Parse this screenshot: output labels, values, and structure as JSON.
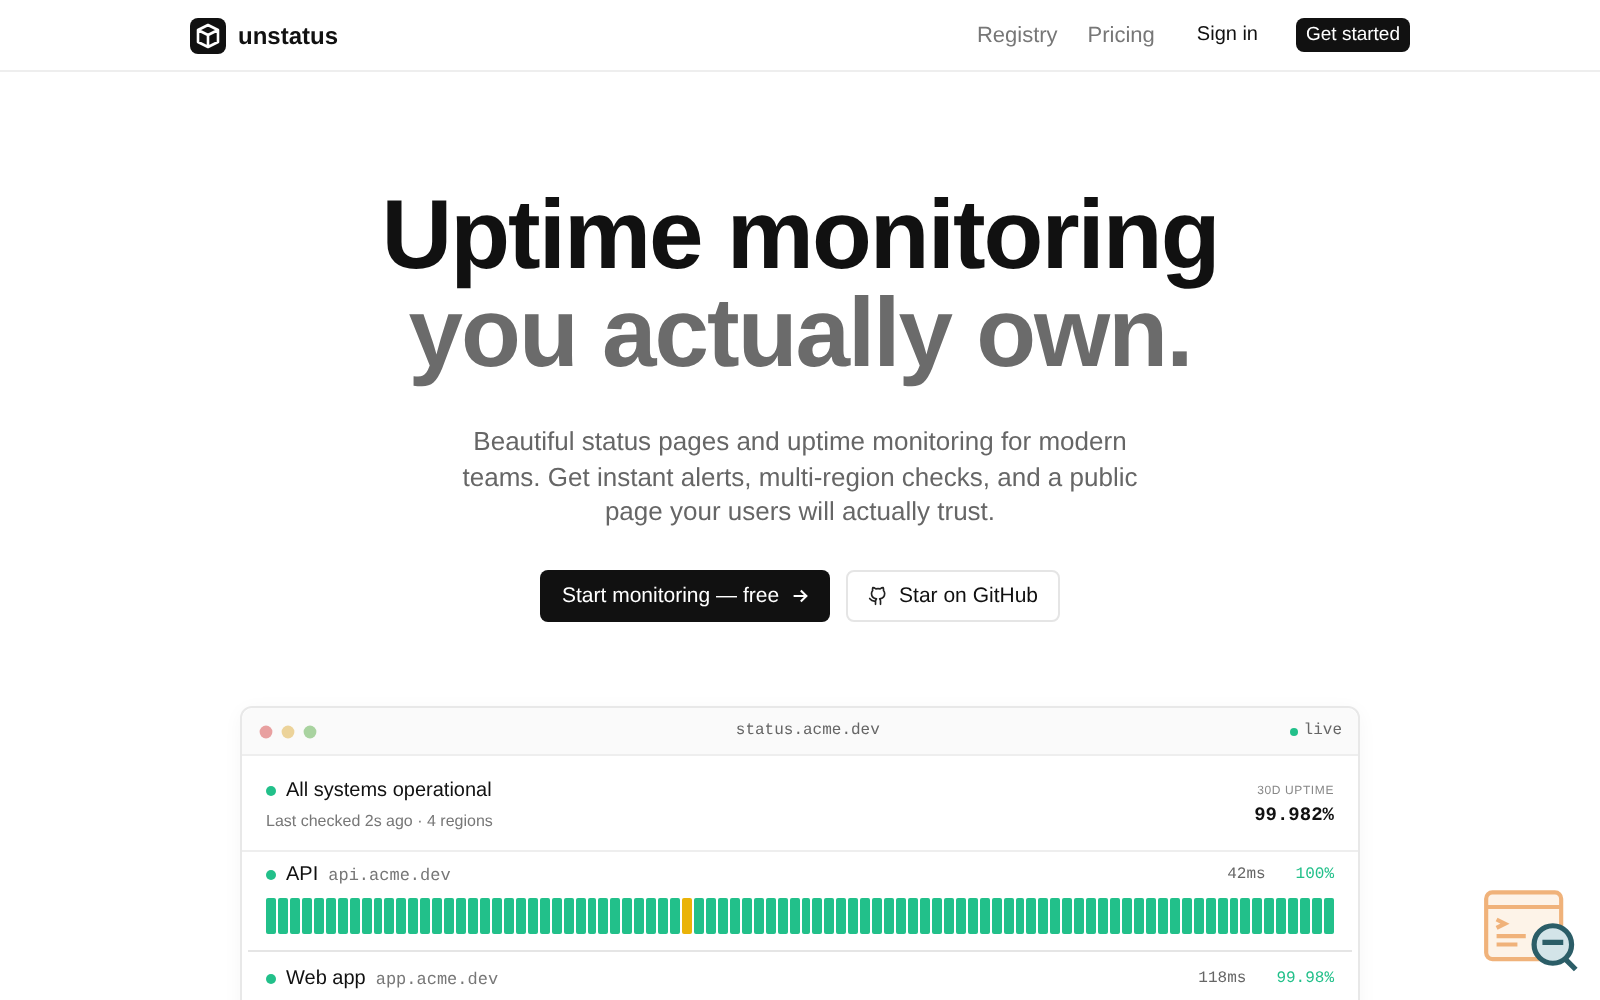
{
  "nav": {
    "brand": "unstatus",
    "links": [
      "Registry",
      "Pricing"
    ],
    "sign_in": "Sign in",
    "cta": "Get started"
  },
  "hero": {
    "title_line_1": "Uptime monitoring",
    "title_line_2": "you actually own.",
    "subtitle": "Beautiful status pages and uptime monitoring for modern teams. Get instant alerts, multi-region checks, and a public page your users will actually trust.",
    "primary_button": "Start monitoring — free",
    "secondary_button": "Star on GitHub"
  },
  "preview": {
    "url": "status.acme.dev",
    "live": "live",
    "summary": {
      "title": "All systems operational",
      "subtitle": "Last checked 2s ago · 4 regions",
      "uptime_label": "30D UPTIME",
      "uptime": "99.982%"
    },
    "services": [
      {
        "name": "API",
        "host": "api.acme.dev",
        "latency": "42ms",
        "uptime": "100%",
        "bars": [
          {
            "color": "#22c08a"
          },
          {
            "color": "#22c08a"
          },
          {
            "color": "#22c08a"
          },
          {
            "color": "#22c08a"
          },
          {
            "color": "#22c08a"
          },
          {
            "color": "#22c08a"
          },
          {
            "color": "#22c08a"
          },
          {
            "color": "#22c08a"
          },
          {
            "color": "#22c08a"
          },
          {
            "color": "#22c08a"
          },
          {
            "color": "#22c08a"
          },
          {
            "color": "#22c08a"
          },
          {
            "color": "#22c08a"
          },
          {
            "color": "#22c08a"
          },
          {
            "color": "#22c08a"
          },
          {
            "color": "#22c08a"
          },
          {
            "color": "#22c08a"
          },
          {
            "color": "#22c08a"
          },
          {
            "color": "#22c08a"
          },
          {
            "color": "#22c08a"
          },
          {
            "color": "#22c08a"
          },
          {
            "color": "#22c08a"
          },
          {
            "color": "#22c08a"
          },
          {
            "color": "#22c08a"
          },
          {
            "color": "#22c08a"
          },
          {
            "color": "#22c08a"
          },
          {
            "color": "#22c08a"
          },
          {
            "color": "#22c08a"
          },
          {
            "color": "#22c08a"
          },
          {
            "color": "#22c08a"
          },
          {
            "color": "#22c08a"
          },
          {
            "color": "#22c08a"
          },
          {
            "color": "#22c08a"
          },
          {
            "color": "#22c08a"
          },
          {
            "color": "#22c08a"
          },
          {
            "color": "#eab308"
          },
          {
            "color": "#22c08a"
          },
          {
            "color": "#22c08a"
          },
          {
            "color": "#22c08a"
          },
          {
            "color": "#22c08a"
          },
          {
            "color": "#22c08a"
          },
          {
            "color": "#22c08a"
          },
          {
            "color": "#22c08a"
          },
          {
            "color": "#22c08a"
          },
          {
            "color": "#22c08a"
          },
          {
            "color": "#22c08a"
          },
          {
            "color": "#22c08a"
          },
          {
            "color": "#22c08a"
          },
          {
            "color": "#22c08a"
          },
          {
            "color": "#22c08a"
          },
          {
            "color": "#22c08a"
          },
          {
            "color": "#22c08a"
          },
          {
            "color": "#22c08a"
          },
          {
            "color": "#22c08a"
          },
          {
            "color": "#22c08a"
          },
          {
            "color": "#22c08a"
          },
          {
            "color": "#22c08a"
          },
          {
            "color": "#22c08a"
          },
          {
            "color": "#22c08a"
          },
          {
            "color": "#22c08a"
          },
          {
            "color": "#22c08a"
          },
          {
            "color": "#22c08a"
          },
          {
            "color": "#22c08a"
          },
          {
            "color": "#22c08a"
          },
          {
            "color": "#22c08a"
          },
          {
            "color": "#22c08a"
          },
          {
            "color": "#22c08a"
          },
          {
            "color": "#22c08a"
          },
          {
            "color": "#22c08a"
          },
          {
            "color": "#22c08a"
          },
          {
            "color": "#22c08a"
          },
          {
            "color": "#22c08a"
          },
          {
            "color": "#22c08a"
          },
          {
            "color": "#22c08a"
          },
          {
            "color": "#22c08a"
          },
          {
            "color": "#22c08a"
          },
          {
            "color": "#22c08a"
          },
          {
            "color": "#22c08a"
          },
          {
            "color": "#22c08a"
          },
          {
            "color": "#22c08a"
          },
          {
            "color": "#22c08a"
          },
          {
            "color": "#22c08a"
          },
          {
            "color": "#22c08a"
          },
          {
            "color": "#22c08a"
          },
          {
            "color": "#22c08a"
          },
          {
            "color": "#22c08a"
          },
          {
            "color": "#22c08a"
          },
          {
            "color": "#22c08a"
          },
          {
            "color": "#22c08a"
          },
          {
            "color": "#22c08a"
          }
        ]
      },
      {
        "name": "Web app",
        "host": "app.acme.dev",
        "latency": "118ms",
        "uptime": "99.98%"
      }
    ]
  }
}
